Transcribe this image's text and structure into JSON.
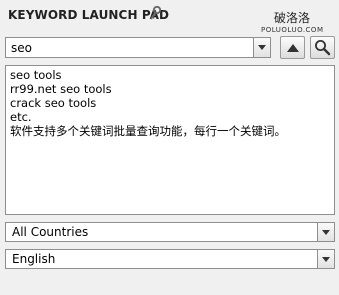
{
  "header": {
    "title": "KEYWORD LAUNCH PAD",
    "watermark_cn": "破洛洛",
    "watermark_en": "POLUOLUO.COM"
  },
  "search": {
    "value": "seo",
    "dropdown_icon": "chevron-down-icon",
    "up_icon": "arrow-up-icon",
    "search_icon": "magnifier-icon"
  },
  "keywords": {
    "lines": [
      "seo tools",
      "rr99.net seo tools",
      "crack seo tools",
      "etc.",
      "软件支持多个关键词批量查询功能，每行一个关键词。"
    ]
  },
  "country_select": {
    "selected": "All Countries"
  },
  "language_select": {
    "selected": "English"
  },
  "colors": {
    "background": "#f0f0f0",
    "border": "#8f8f8f",
    "text": "#000000"
  }
}
